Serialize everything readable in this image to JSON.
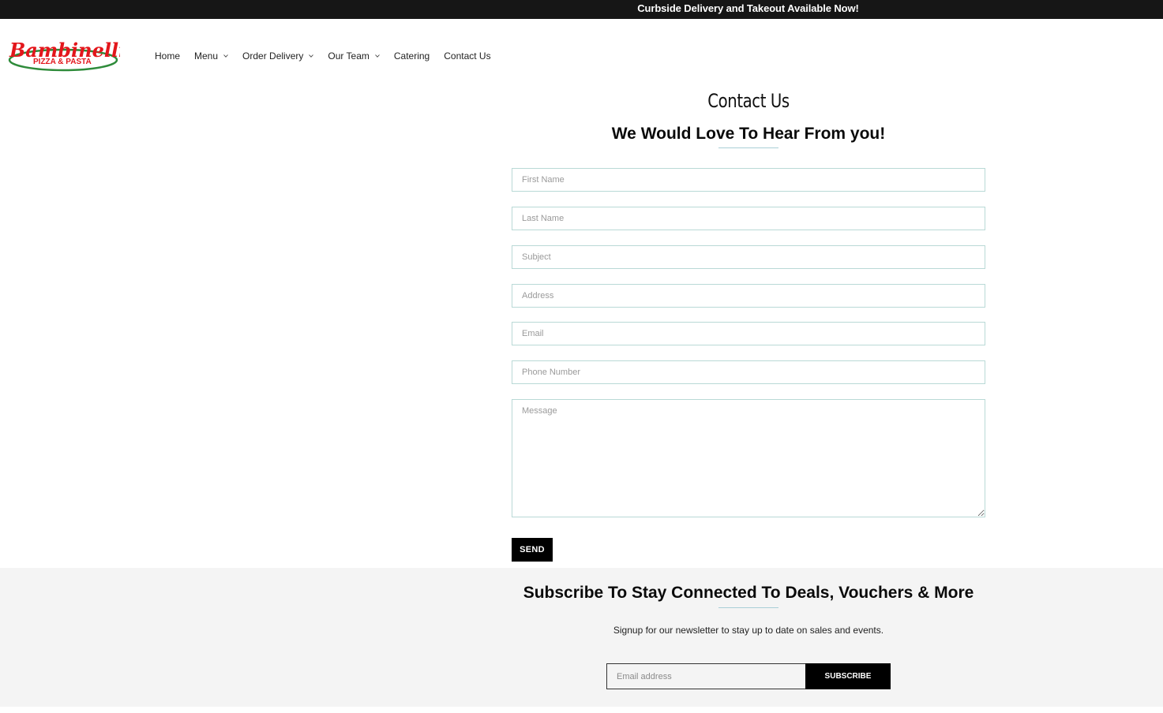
{
  "announcement": {
    "text": "Curbside Delivery and Takeout Available Now!"
  },
  "brand": {
    "logo_line1": "Bambinelli's",
    "logo_line2": "PIZZA & PASTA",
    "colors": {
      "red": "#e3161b",
      "green": "#2e8b3a"
    }
  },
  "nav": {
    "items": [
      {
        "label": "Home",
        "dropdown": false
      },
      {
        "label": "Menu",
        "dropdown": true
      },
      {
        "label": "Order Delivery",
        "dropdown": true
      },
      {
        "label": "Our Team",
        "dropdown": true
      },
      {
        "label": "Catering",
        "dropdown": false
      },
      {
        "label": "Contact Us",
        "dropdown": false
      }
    ]
  },
  "contact": {
    "title": "Contact Us",
    "subtitle": "We Would Love To Hear From you!",
    "fields": {
      "first_name": "First Name",
      "last_name": "Last Name",
      "subject": "Subject",
      "address": "Address",
      "email": "Email",
      "phone": "Phone Number",
      "message": "Message"
    },
    "send_label": "SEND"
  },
  "newsletter": {
    "title": "Subscribe To Stay Connected To Deals, Vouchers & More",
    "text": "Signup for our newsletter to stay up to date on sales and events.",
    "email_placeholder": "Email address",
    "subscribe_label": "SUBSCRIBE"
  },
  "colors": {
    "announcement_bg": "#161616",
    "field_border": "#b9d9d6",
    "accent_underline": "#a9cfd6",
    "footer_bg": "#f4f4f4"
  }
}
